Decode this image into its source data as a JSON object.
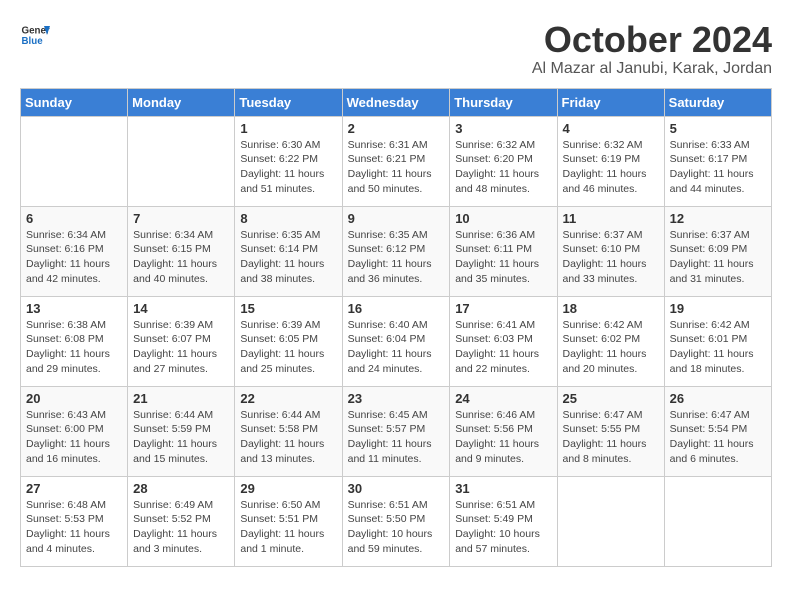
{
  "header": {
    "logo_general": "General",
    "logo_blue": "Blue",
    "month_title": "October 2024",
    "location": "Al Mazar al Janubi, Karak, Jordan"
  },
  "weekdays": [
    "Sunday",
    "Monday",
    "Tuesday",
    "Wednesday",
    "Thursday",
    "Friday",
    "Saturday"
  ],
  "weeks": [
    [
      {
        "day": "",
        "info": ""
      },
      {
        "day": "",
        "info": ""
      },
      {
        "day": "1",
        "info": "Sunrise: 6:30 AM\nSunset: 6:22 PM\nDaylight: 11 hours and 51 minutes."
      },
      {
        "day": "2",
        "info": "Sunrise: 6:31 AM\nSunset: 6:21 PM\nDaylight: 11 hours and 50 minutes."
      },
      {
        "day": "3",
        "info": "Sunrise: 6:32 AM\nSunset: 6:20 PM\nDaylight: 11 hours and 48 minutes."
      },
      {
        "day": "4",
        "info": "Sunrise: 6:32 AM\nSunset: 6:19 PM\nDaylight: 11 hours and 46 minutes."
      },
      {
        "day": "5",
        "info": "Sunrise: 6:33 AM\nSunset: 6:17 PM\nDaylight: 11 hours and 44 minutes."
      }
    ],
    [
      {
        "day": "6",
        "info": "Sunrise: 6:34 AM\nSunset: 6:16 PM\nDaylight: 11 hours and 42 minutes."
      },
      {
        "day": "7",
        "info": "Sunrise: 6:34 AM\nSunset: 6:15 PM\nDaylight: 11 hours and 40 minutes."
      },
      {
        "day": "8",
        "info": "Sunrise: 6:35 AM\nSunset: 6:14 PM\nDaylight: 11 hours and 38 minutes."
      },
      {
        "day": "9",
        "info": "Sunrise: 6:35 AM\nSunset: 6:12 PM\nDaylight: 11 hours and 36 minutes."
      },
      {
        "day": "10",
        "info": "Sunrise: 6:36 AM\nSunset: 6:11 PM\nDaylight: 11 hours and 35 minutes."
      },
      {
        "day": "11",
        "info": "Sunrise: 6:37 AM\nSunset: 6:10 PM\nDaylight: 11 hours and 33 minutes."
      },
      {
        "day": "12",
        "info": "Sunrise: 6:37 AM\nSunset: 6:09 PM\nDaylight: 11 hours and 31 minutes."
      }
    ],
    [
      {
        "day": "13",
        "info": "Sunrise: 6:38 AM\nSunset: 6:08 PM\nDaylight: 11 hours and 29 minutes."
      },
      {
        "day": "14",
        "info": "Sunrise: 6:39 AM\nSunset: 6:07 PM\nDaylight: 11 hours and 27 minutes."
      },
      {
        "day": "15",
        "info": "Sunrise: 6:39 AM\nSunset: 6:05 PM\nDaylight: 11 hours and 25 minutes."
      },
      {
        "day": "16",
        "info": "Sunrise: 6:40 AM\nSunset: 6:04 PM\nDaylight: 11 hours and 24 minutes."
      },
      {
        "day": "17",
        "info": "Sunrise: 6:41 AM\nSunset: 6:03 PM\nDaylight: 11 hours and 22 minutes."
      },
      {
        "day": "18",
        "info": "Sunrise: 6:42 AM\nSunset: 6:02 PM\nDaylight: 11 hours and 20 minutes."
      },
      {
        "day": "19",
        "info": "Sunrise: 6:42 AM\nSunset: 6:01 PM\nDaylight: 11 hours and 18 minutes."
      }
    ],
    [
      {
        "day": "20",
        "info": "Sunrise: 6:43 AM\nSunset: 6:00 PM\nDaylight: 11 hours and 16 minutes."
      },
      {
        "day": "21",
        "info": "Sunrise: 6:44 AM\nSunset: 5:59 PM\nDaylight: 11 hours and 15 minutes."
      },
      {
        "day": "22",
        "info": "Sunrise: 6:44 AM\nSunset: 5:58 PM\nDaylight: 11 hours and 13 minutes."
      },
      {
        "day": "23",
        "info": "Sunrise: 6:45 AM\nSunset: 5:57 PM\nDaylight: 11 hours and 11 minutes."
      },
      {
        "day": "24",
        "info": "Sunrise: 6:46 AM\nSunset: 5:56 PM\nDaylight: 11 hours and 9 minutes."
      },
      {
        "day": "25",
        "info": "Sunrise: 6:47 AM\nSunset: 5:55 PM\nDaylight: 11 hours and 8 minutes."
      },
      {
        "day": "26",
        "info": "Sunrise: 6:47 AM\nSunset: 5:54 PM\nDaylight: 11 hours and 6 minutes."
      }
    ],
    [
      {
        "day": "27",
        "info": "Sunrise: 6:48 AM\nSunset: 5:53 PM\nDaylight: 11 hours and 4 minutes."
      },
      {
        "day": "28",
        "info": "Sunrise: 6:49 AM\nSunset: 5:52 PM\nDaylight: 11 hours and 3 minutes."
      },
      {
        "day": "29",
        "info": "Sunrise: 6:50 AM\nSunset: 5:51 PM\nDaylight: 11 hours and 1 minute."
      },
      {
        "day": "30",
        "info": "Sunrise: 6:51 AM\nSunset: 5:50 PM\nDaylight: 10 hours and 59 minutes."
      },
      {
        "day": "31",
        "info": "Sunrise: 6:51 AM\nSunset: 5:49 PM\nDaylight: 10 hours and 57 minutes."
      },
      {
        "day": "",
        "info": ""
      },
      {
        "day": "",
        "info": ""
      }
    ]
  ]
}
